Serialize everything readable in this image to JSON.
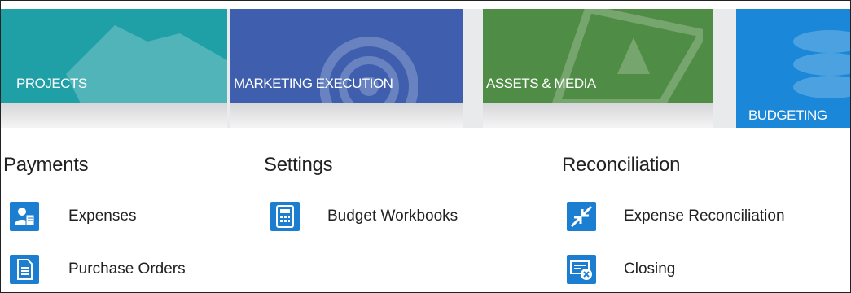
{
  "tiles": [
    {
      "label": "PROJECTS",
      "color": "#1f9fa6"
    },
    {
      "label": "MARKETING EXECUTION",
      "color": "#3f5fae"
    },
    {
      "label": "ASSETS & MEDIA",
      "color": "#4f8c45"
    },
    {
      "label": "BUDGETING",
      "color": "#1a87d8",
      "active": true
    }
  ],
  "sections": {
    "payments": {
      "title": "Payments",
      "items": [
        {
          "label": "Expenses",
          "icon": "expenses-icon"
        },
        {
          "label": "Purchase Orders",
          "icon": "purchase-orders-icon"
        }
      ]
    },
    "settings": {
      "title": "Settings",
      "items": [
        {
          "label": "Budget Workbooks",
          "icon": "calculator-icon"
        }
      ]
    },
    "reconciliation": {
      "title": "Reconciliation",
      "items": [
        {
          "label": "Expense Reconciliation",
          "icon": "collapse-arrows-icon"
        },
        {
          "label": "Closing",
          "icon": "closing-icon"
        }
      ]
    }
  }
}
